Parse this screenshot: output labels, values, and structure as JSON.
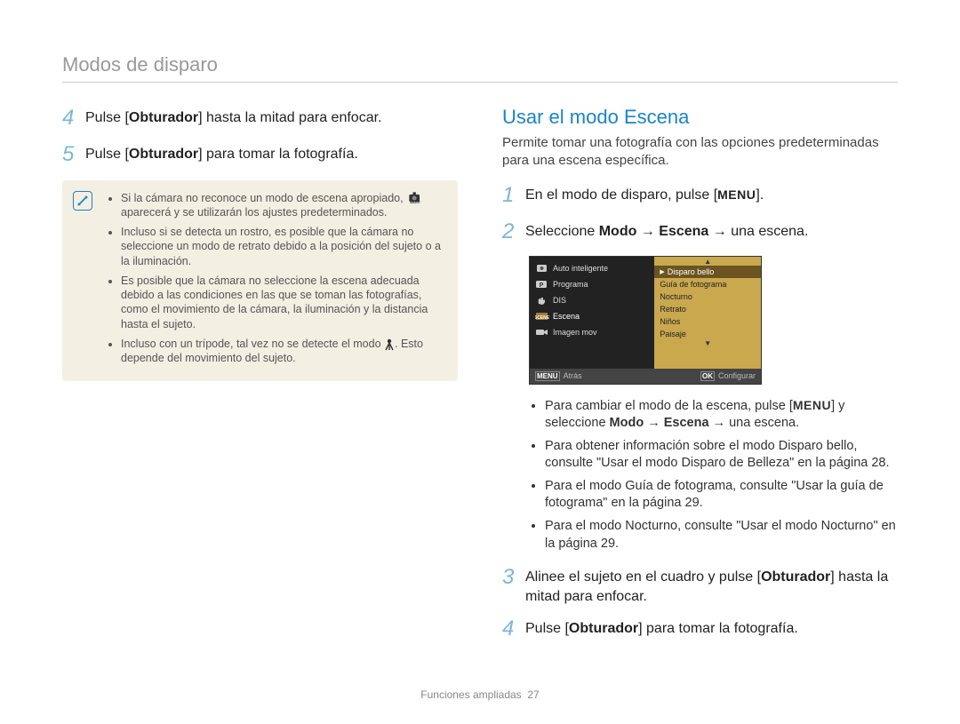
{
  "header": "Modos de disparo",
  "left": {
    "steps": [
      {
        "num": "4",
        "pre": "Pulse [",
        "button": "Obturador",
        "post": "] hasta la mitad para enfocar."
      },
      {
        "num": "5",
        "pre": "Pulse [",
        "button": "Obturador",
        "post": "] para tomar la fotografía."
      }
    ],
    "tips": [
      "Si la cámara no reconoce un modo de escena apropiado, aparecerá y se utilizarán los ajustes predeterminados.",
      "Incluso si se detecta un rostro, es posible que la cámara no seleccione un modo de retrato debido a la posición del sujeto o a la iluminación.",
      "Es posible que la cámara no seleccione la escena adecuada debido a las condiciones en las que se toman las fotografías, como el movimiento de la cámara, la iluminación y la distancia hasta el sujeto.",
      "Incluso con un trípode, tal vez no se detecte el modo. Esto depende del movimiento del sujeto."
    ]
  },
  "right": {
    "title": "Usar el modo Escena",
    "desc": "Permite tomar una fotografía con las opciones predeterminadas para una escena específica.",
    "step1": {
      "num": "1",
      "text": "En el modo de disparo, pulse [",
      "key": "MENU",
      "post": "]."
    },
    "step2": {
      "num": "2",
      "pre": "Seleccione ",
      "b1": "Modo",
      "arrow1": " → ",
      "b2": "Escena",
      "arrow2": " → ",
      "post": "una escena."
    },
    "camera": {
      "leftItems": [
        {
          "icon": "smart",
          "label": "Auto inteligente"
        },
        {
          "icon": "camP",
          "label": "Programa"
        },
        {
          "icon": "hand",
          "label": "DIS"
        },
        {
          "icon": "scene",
          "label": "Escena"
        },
        {
          "icon": "video",
          "label": "Imagen mov"
        }
      ],
      "rightItems": [
        {
          "label": "Disparo bello",
          "selected": true
        },
        {
          "label": "Guía de fotograma"
        },
        {
          "label": "Nocturno"
        },
        {
          "label": "Retrato"
        },
        {
          "label": "Niños"
        },
        {
          "label": "Paisaje"
        }
      ],
      "footer": {
        "leftKey": "MENU",
        "leftLabel": "Atrás",
        "rightKey": "OK",
        "rightLabel": "Configurar"
      }
    },
    "subbullets": [
      {
        "pre": "Para cambiar el modo de la escena, pulse [",
        "key": "MENU",
        "mid": "] y seleccione ",
        "b": "Modo → Escena →",
        "post": " una escena."
      },
      {
        "full": "Para obtener información sobre el modo Disparo bello, consulte \"Usar el modo Disparo de Belleza\" en la página 28."
      },
      {
        "full": "Para el modo Guía de fotograma, consulte \"Usar la guía de fotograma\" en la página 29."
      },
      {
        "full": "Para el modo Nocturno, consulte \"Usar el modo Nocturno\" en la página 29."
      }
    ],
    "step3": {
      "num": "3",
      "pre": "Alinee el sujeto en el cuadro y pulse [",
      "button": "Obturador",
      "post": "] hasta la mitad para enfocar."
    },
    "step4": {
      "num": "4",
      "pre": "Pulse [",
      "button": "Obturador",
      "post": "] para tomar la fotografía."
    }
  },
  "footer": {
    "label": "Funciones ampliadas",
    "page": "27"
  }
}
